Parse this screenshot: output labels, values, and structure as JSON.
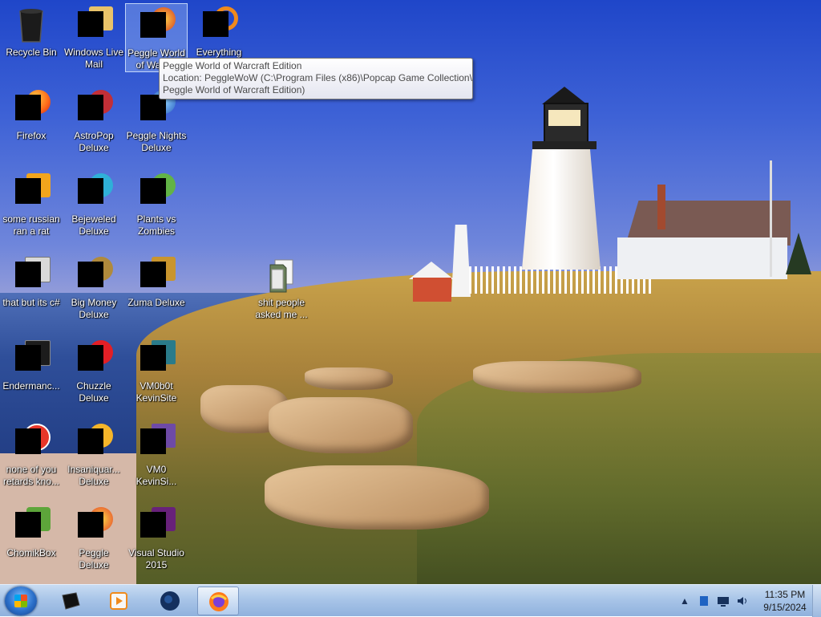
{
  "desktop": {
    "icons": [
      {
        "label": "Recycle Bin"
      },
      {
        "label": "Windows Live Mail"
      },
      {
        "label": "Peggle World of Warcraft Edition",
        "short": "Peggle World of Warc..."
      },
      {
        "label": "Everything"
      },
      {
        "label": "Firefox"
      },
      {
        "label": "AstroPop Deluxe"
      },
      {
        "label": "Peggle Nights Deluxe"
      },
      {
        "label": "some russian ran a rat"
      },
      {
        "label": "Bejeweled Deluxe"
      },
      {
        "label": "Plants vs Zombies"
      },
      {
        "label": "that but its c#"
      },
      {
        "label": "Big Money Deluxe"
      },
      {
        "label": "Zuma Deluxe"
      },
      {
        "label": "shit people asked me ..."
      },
      {
        "label": "Endermanc..."
      },
      {
        "label": "Chuzzle Deluxe"
      },
      {
        "label": "VM0b0t KevinSite"
      },
      {
        "label": "none of you retards kno..."
      },
      {
        "label": "Insaniquar... Deluxe"
      },
      {
        "label": "VM0 KevinSi..."
      },
      {
        "label": "ChomikBox"
      },
      {
        "label": "Peggle Deluxe"
      },
      {
        "label": "Visual Studio 2015"
      }
    ]
  },
  "tooltip": {
    "line1": "Peggle World of Warcraft Edition",
    "line2": "Location: PeggleWoW (C:\\Program Files (x86)\\Popcap Game Collection\\",
    "line3": "Peggle World of Warcraft Edition)"
  },
  "taskbar": {
    "clock_time": "11:35 PM",
    "clock_date": "9/15/2024",
    "pinned": [
      "terminal-app-icon",
      "media-player-icon",
      "globe-app-icon",
      "firefox-icon"
    ],
    "tray": [
      "show-hidden-icons-chevron",
      "tray-app-icon",
      "monitor-icon",
      "volume-icon"
    ]
  },
  "colors": {
    "taskbar_top": "#c8dcf2",
    "taskbar_bottom": "#8fb1dd",
    "tooltip_text": "#4b4b4b"
  }
}
